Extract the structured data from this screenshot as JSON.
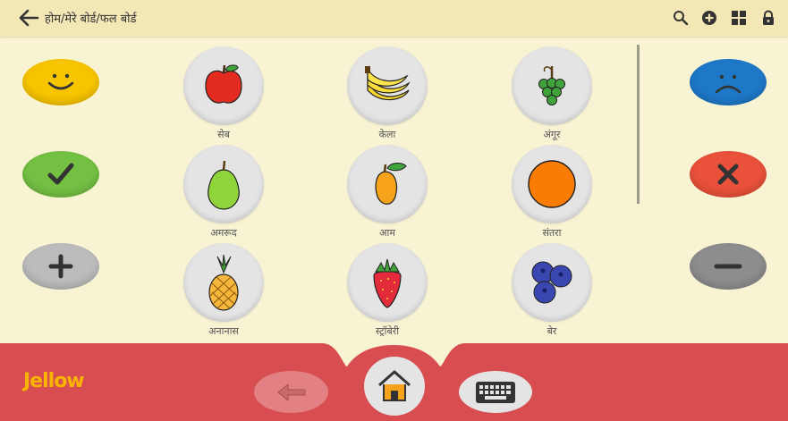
{
  "breadcrumb": "होम/मेरे बोर्ड/फल बोर्ड",
  "tiles": [
    {
      "label": "सेब",
      "icon": "apple-icon"
    },
    {
      "label": "केला",
      "icon": "banana-icon"
    },
    {
      "label": "अंगूर",
      "icon": "grapes-icon"
    },
    {
      "label": "अमरूद",
      "icon": "guava-icon"
    },
    {
      "label": "आम",
      "icon": "mango-icon"
    },
    {
      "label": "संतरा",
      "icon": "orange-icon"
    },
    {
      "label": "अनानास",
      "icon": "pineapple-icon"
    },
    {
      "label": "स्ट्रॉबेरी",
      "icon": "strawberry-icon"
    },
    {
      "label": "बेर",
      "icon": "berry-icon"
    }
  ],
  "brand": {
    "name": "Jellow",
    "color": "#f7b500"
  },
  "colors": {
    "accent": "#d84d4f",
    "background": "#f8f3d3",
    "topbar": "#f3e7b5",
    "yes": "#f7c400",
    "ok": "#74c043",
    "no": "#1e78c8",
    "cross": "#e9513a"
  }
}
